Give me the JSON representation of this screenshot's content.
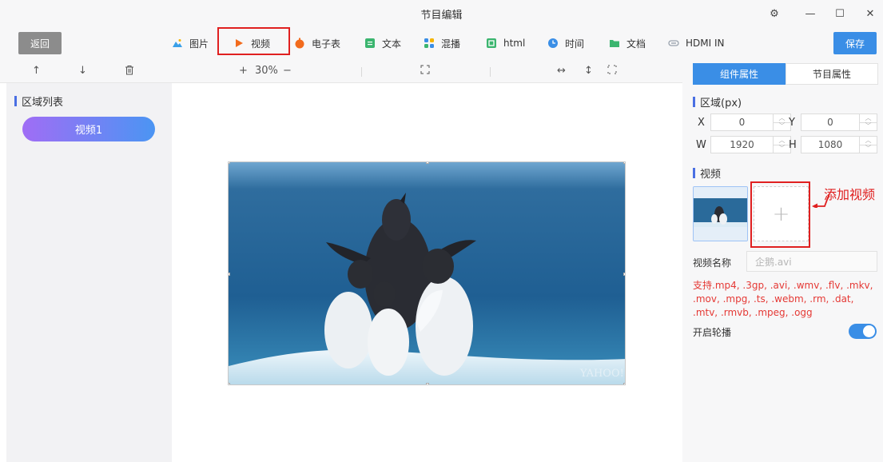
{
  "window": {
    "title": "节目编辑",
    "controls": {
      "settings": "⚙",
      "minimize": "—",
      "maximize": "☐",
      "close": "✕"
    }
  },
  "toolbar": {
    "back_label": "返回",
    "save_label": "保存",
    "items": [
      {
        "label": "图片",
        "icon": "image-icon",
        "color": "#3aa0e8"
      },
      {
        "label": "视频",
        "icon": "video-play-icon",
        "color": "#f26b1d"
      },
      {
        "label": "电子表",
        "icon": "clock-stopwatch-icon",
        "color": "#f26b1d"
      },
      {
        "label": "文本",
        "icon": "text-icon",
        "color": "#3bb56f"
      },
      {
        "label": "混播",
        "icon": "mixed-play-icon",
        "color": "#3a8ee6"
      },
      {
        "label": "html",
        "icon": "html-icon",
        "color": "#3bb56f"
      },
      {
        "label": "时间",
        "icon": "time-icon",
        "color": "#3a8ee6"
      },
      {
        "label": "文档",
        "icon": "document-icon",
        "color": "#3bb56f"
      },
      {
        "label": "HDMI IN",
        "icon": "hdmi-icon",
        "color": "#9aa3ae"
      }
    ]
  },
  "controls_row": {
    "move_up": "↑",
    "move_down": "↓",
    "delete": "🗑",
    "zoom_in": "+",
    "zoom_level": "30%",
    "zoom_out": "−",
    "fit_screen": "⛶",
    "fit_width": "↔",
    "fit_height": "↕",
    "fullscreen": "⤢"
  },
  "left_panel": {
    "heading": "区域列表",
    "regions": [
      {
        "label": "视频1"
      }
    ]
  },
  "right_panel": {
    "tabs": [
      {
        "label": "组件属性",
        "active": true
      },
      {
        "label": "节目属性",
        "active": false
      }
    ],
    "area_section": {
      "heading": "区域(px)",
      "x_label": "X",
      "x_value": "0",
      "y_label": "Y",
      "y_value": "0",
      "w_label": "W",
      "w_value": "1920",
      "h_label": "H",
      "h_value": "1080"
    },
    "video_section": {
      "heading": "视频",
      "add_symbol": "+",
      "name_label": "视频名称",
      "name_placeholder": "企鹅.avi",
      "formats": "支持.mp4, .3gp, .avi, .wmv, .flv, .mkv, .mov, .mpg, .ts, .webm, .rm, .dat, .mtv, .rmvb, .mpeg, .ogg",
      "loop_label": "开启轮播",
      "loop_enabled": true
    }
  },
  "annotation": {
    "text": "添加视频",
    "color": "#e02020"
  },
  "colors": {
    "accent": "#3a8ee6",
    "highlight_red": "#e02020",
    "pill_start": "#a06df5",
    "pill_end": "#4b95f3"
  }
}
